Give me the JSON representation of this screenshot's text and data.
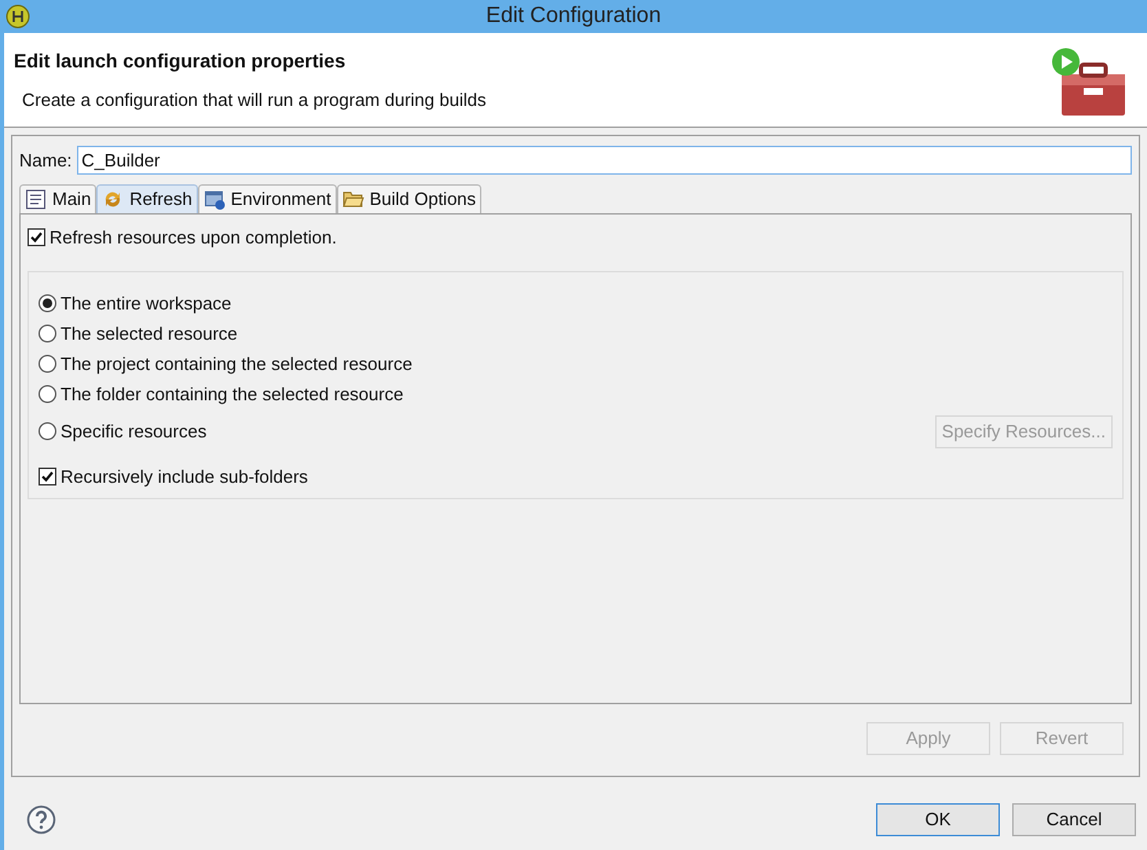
{
  "window": {
    "title": "Edit Configuration"
  },
  "header": {
    "title": "Edit launch configuration properties",
    "description": "Create a configuration that will run a program during builds"
  },
  "name_field": {
    "label": "Name:",
    "value": "C_Builder"
  },
  "tabs": [
    {
      "label": "Main",
      "kind": "main",
      "selected": false
    },
    {
      "label": "Refresh",
      "kind": "refresh",
      "selected": true
    },
    {
      "label": "Environment",
      "kind": "environment",
      "selected": false
    },
    {
      "label": "Build Options",
      "kind": "folder",
      "selected": false
    }
  ],
  "refresh_checkbox": {
    "label": "Refresh resources upon completion.",
    "checked": true
  },
  "scope_options": [
    {
      "label": "The entire workspace",
      "selected": true
    },
    {
      "label": "The selected resource",
      "selected": false
    },
    {
      "label": "The project containing the selected resource",
      "selected": false
    },
    {
      "label": "The folder containing the selected resource",
      "selected": false
    },
    {
      "label": "Specific resources",
      "selected": false
    }
  ],
  "specify_button": {
    "label": "Specify Resources...",
    "disabled": true
  },
  "recursive_checkbox": {
    "label": "Recursively include sub-folders",
    "checked": true
  },
  "tab_buttons": [
    {
      "label": "Apply",
      "disabled": true
    },
    {
      "label": "Revert",
      "disabled": true
    }
  ],
  "dialog_buttons": [
    {
      "label": "OK",
      "default": true
    },
    {
      "label": "Cancel",
      "default": false
    }
  ]
}
